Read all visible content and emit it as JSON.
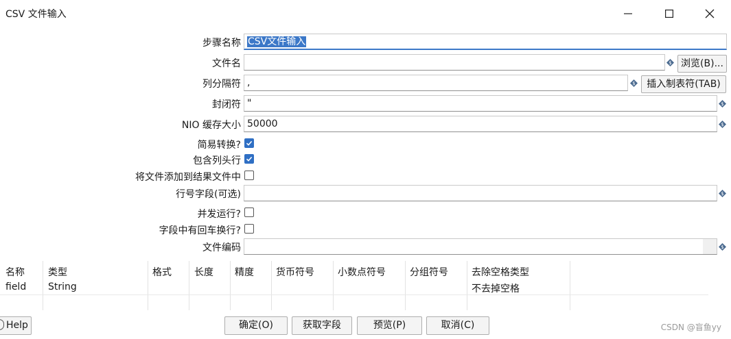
{
  "window": {
    "title": "CSV 文件输入"
  },
  "form": {
    "step_name": {
      "label": "步骤名称",
      "value": "CSV文件输入"
    },
    "filename": {
      "label": "文件名",
      "value": ""
    },
    "browse_button": "浏览(B)...",
    "delimiter": {
      "label": "列分隔符",
      "value": ","
    },
    "insert_tab_button": "插入制表符(TAB)",
    "enclosure": {
      "label": "封闭符",
      "value": "\""
    },
    "nio_buffer": {
      "label": "NIO 缓存大小",
      "value": "50000"
    },
    "lazy_conversion": {
      "label": "简易转换?",
      "checked": true
    },
    "header_row": {
      "label": "包含列头行",
      "checked": true
    },
    "add_to_result": {
      "label": "将文件添加到结果文件中",
      "checked": false
    },
    "row_number_field": {
      "label": "行号字段(可选)",
      "value": ""
    },
    "parallel": {
      "label": "并发运行?",
      "checked": false
    },
    "newlines_in_fields": {
      "label": "字段中有回车换行?",
      "checked": false
    },
    "encoding": {
      "label": "文件编码",
      "value": ""
    }
  },
  "grid": {
    "columns": [
      "名称",
      "类型",
      "格式",
      "长度",
      "精度",
      "货币符号",
      "小数点符号",
      "分组符号",
      "去除空格类型"
    ],
    "rows": [
      [
        "field",
        "String",
        "",
        "",
        "",
        "",
        "",
        "",
        "不去掉空格"
      ]
    ]
  },
  "buttons": {
    "help": "Help",
    "ok": "确定(O)",
    "get_fields": "获取字段",
    "preview": "预览(P)",
    "cancel": "取消(C)"
  },
  "watermark": "CSDN @盲鱼yy",
  "colors": {
    "accent": "#3c78c8",
    "checkbox": "#2f6fc4",
    "variable_icon": "#4a6a8f"
  }
}
